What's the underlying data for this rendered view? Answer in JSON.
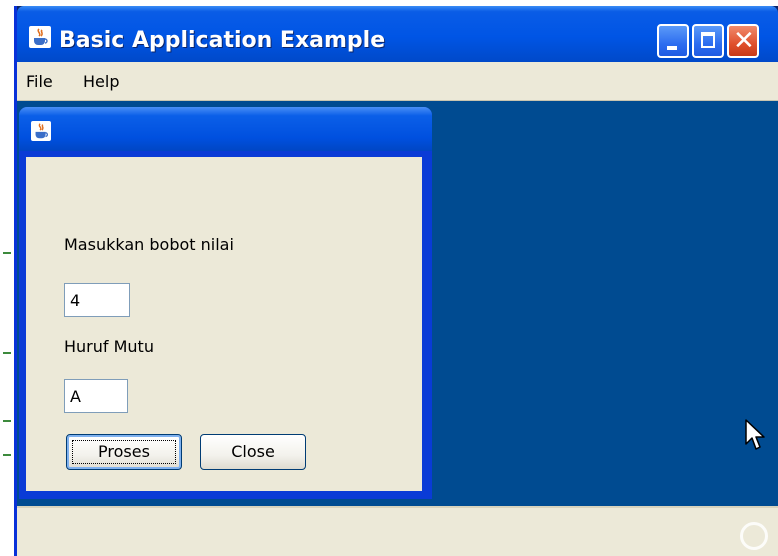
{
  "window": {
    "title": "Basic Application Example",
    "controls": [
      "minimize-icon",
      "maximize-icon",
      "close-icon"
    ],
    "close_glyph": "✕"
  },
  "menubar": {
    "items": [
      {
        "label": "File"
      },
      {
        "label": "Help"
      }
    ]
  },
  "dialog": {
    "icon": "java-icon",
    "bobot_label": "Masukkan bobot nilai",
    "bobot_value": "4",
    "huruf_label": "Huruf Mutu",
    "huruf_value": "A",
    "proses_label": "Proses",
    "close_label": "Close"
  },
  "colors": {
    "desktop_pane": "#004b91",
    "titlebar": "#0055e5",
    "panel": "#ece9d8"
  }
}
